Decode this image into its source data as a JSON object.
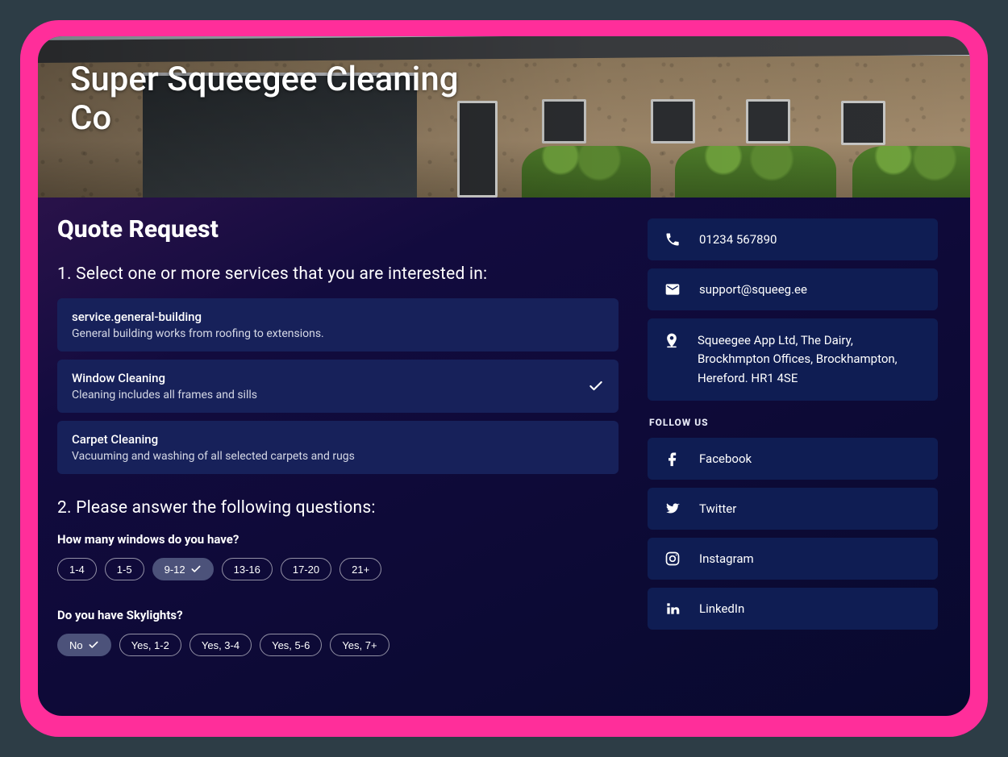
{
  "hero": {
    "title": "Super Squeegee Cleaning Co"
  },
  "main": {
    "page_title": "Quote Request",
    "section1_heading": "1. Select one or more services that you are interested in:",
    "services": [
      {
        "label": "service.general-building",
        "desc": "General building works from roofing to extensions.",
        "selected": false
      },
      {
        "label": "Window Cleaning",
        "desc": "Cleaning includes all frames and sills",
        "selected": true
      },
      {
        "label": "Carpet Cleaning",
        "desc": "Vacuuming and washing of all selected carpets and rugs",
        "selected": false
      }
    ],
    "section2_heading": "2. Please answer the following questions:",
    "questions": [
      {
        "label": "How many windows do you have?",
        "options": [
          {
            "text": "1-4",
            "selected": false
          },
          {
            "text": "1-5",
            "selected": false
          },
          {
            "text": "9-12",
            "selected": true
          },
          {
            "text": "13-16",
            "selected": false
          },
          {
            "text": "17-20",
            "selected": false
          },
          {
            "text": "21+",
            "selected": false
          }
        ]
      },
      {
        "label": "Do you have Skylights?",
        "options": [
          {
            "text": "No",
            "selected": true
          },
          {
            "text": "Yes, 1-2",
            "selected": false
          },
          {
            "text": "Yes, 3-4",
            "selected": false
          },
          {
            "text": "Yes, 5-6",
            "selected": false
          },
          {
            "text": "Yes, 7+",
            "selected": false
          }
        ]
      }
    ]
  },
  "sidebar": {
    "phone": "01234 567890",
    "email": "support@squeeg.ee",
    "address": "Squeegee App Ltd, The Dairy, Brockhmpton Offices, Brockhampton, Hereford. HR1 4SE",
    "follow_title": "FOLLOW US",
    "socials": [
      {
        "name": "Facebook",
        "icon": "facebook"
      },
      {
        "name": "Twitter",
        "icon": "twitter"
      },
      {
        "name": "Instagram",
        "icon": "instagram"
      },
      {
        "name": "LinkedIn",
        "icon": "linkedin"
      }
    ]
  }
}
